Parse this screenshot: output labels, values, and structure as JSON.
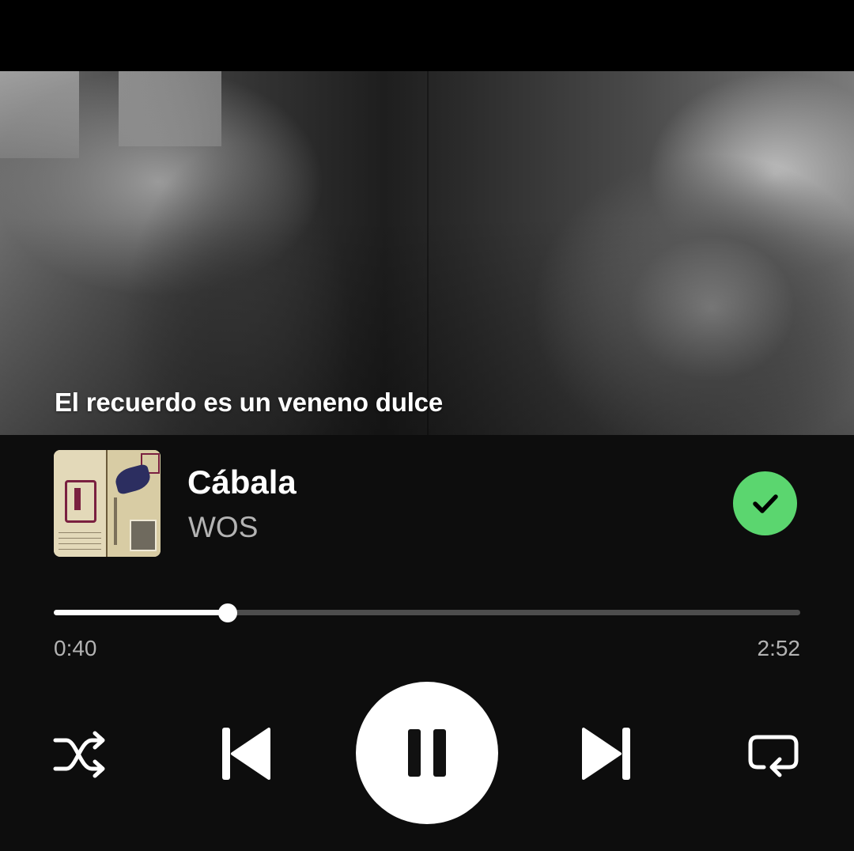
{
  "lyrics": {
    "current_line": "El recuerdo es un veneno dulce"
  },
  "track": {
    "title": "Cábala",
    "artist": "WOS",
    "saved": true
  },
  "progress": {
    "elapsed": "0:40",
    "total": "2:52",
    "fraction": 0.2326
  },
  "controls": {
    "shuffle_icon": "shuffle-icon",
    "previous_icon": "skip-previous-icon",
    "playpause_icon": "pause-icon",
    "next_icon": "skip-next-icon",
    "repeat_icon": "repeat-icon"
  },
  "colors": {
    "accent": "#5bd66f",
    "background": "#0d0d0d",
    "track_bg": "#4d4d4d",
    "secondary_text": "#b3b3b3"
  }
}
